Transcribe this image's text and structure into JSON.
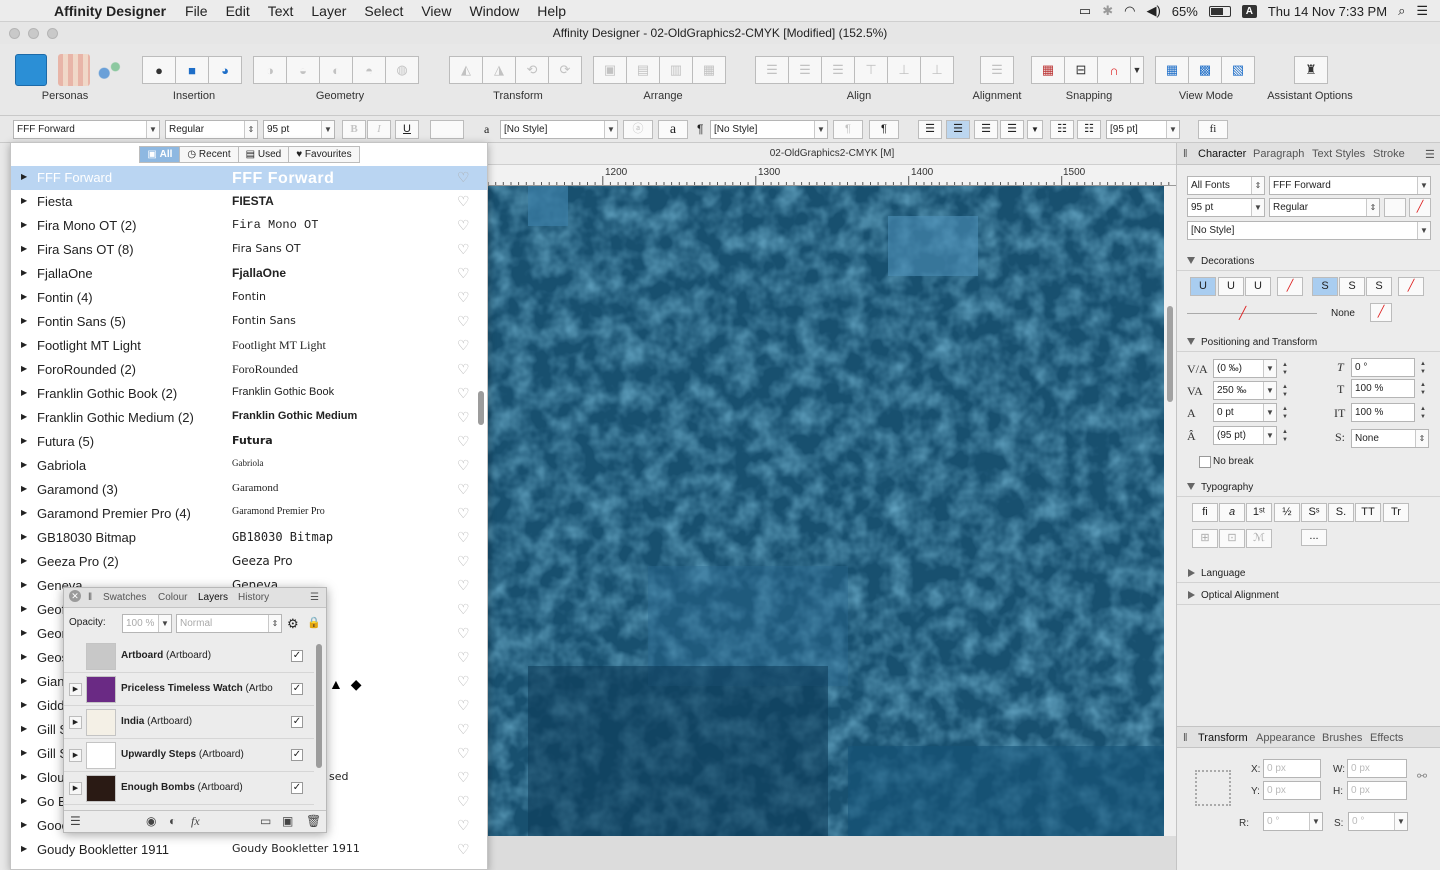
{
  "menubar": {
    "app_name": "Affinity Designer",
    "items": [
      "File",
      "Edit",
      "Text",
      "Layer",
      "Select",
      "View",
      "Window",
      "Help"
    ],
    "battery": "65%",
    "account": "A",
    "clock": "Thu 14 Nov  7:33 PM"
  },
  "window": {
    "title": "Affinity Designer - 02-OldGraphics2-CMYK [Modified] (152.5%)"
  },
  "toolbar": {
    "labels": {
      "personas": "Personas",
      "insertion": "Insertion",
      "geometry": "Geometry",
      "transform": "Transform",
      "arrange": "Arrange",
      "align": "Align",
      "alignment": "Alignment",
      "snapping": "Snapping",
      "view_mode": "View Mode",
      "assistant": "Assistant Options"
    }
  },
  "context": {
    "font_family": "FFF Forward",
    "font_style": "Regular",
    "font_size": "95 pt",
    "bold": "B",
    "italic": "I",
    "underline": "U",
    "char_style": "[No Style]",
    "para_style": "[No Style]",
    "pilcrow": "¶",
    "leading": "[95 pt]",
    "ligature": "fi",
    "a_glyph": "a"
  },
  "font_panel": {
    "filters": [
      "All",
      "Recent",
      "Used",
      "Favourites"
    ],
    "fonts": [
      {
        "name": "FFF Forward",
        "preview": "FFF Forward"
      },
      {
        "name": "Fiesta",
        "preview": "FIESTA"
      },
      {
        "name": "Fira Mono OT (2)",
        "preview": "Fira Mono OT"
      },
      {
        "name": "Fira Sans OT (8)",
        "preview": "Fira Sans OT"
      },
      {
        "name": "FjallaOne",
        "preview": "FjallaOne"
      },
      {
        "name": "Fontin (4)",
        "preview": "Fontin"
      },
      {
        "name": "Fontin Sans (5)",
        "preview": "Fontin Sans"
      },
      {
        "name": "Footlight MT Light",
        "preview": "Footlight MT Light"
      },
      {
        "name": "ForoRounded (2)",
        "preview": "ForoRounded"
      },
      {
        "name": "Franklin Gothic Book (2)",
        "preview": "Franklin Gothic Book"
      },
      {
        "name": "Franklin Gothic Medium (2)",
        "preview": "Franklin Gothic Medium"
      },
      {
        "name": "Futura (5)",
        "preview": "Futura"
      },
      {
        "name": "Gabriola",
        "preview": "Gabriola"
      },
      {
        "name": "Garamond (3)",
        "preview": "Garamond"
      },
      {
        "name": "Garamond Premier Pro (4)",
        "preview": "Garamond Premier Pro"
      },
      {
        "name": "GB18030 Bitmap",
        "preview": "GB18030  Bitmap"
      },
      {
        "name": "Geeza Pro (2)",
        "preview": "Geeza Pro"
      },
      {
        "name": "Geneva",
        "preview": "Geneva"
      },
      {
        "name": "Geof",
        "preview": ""
      },
      {
        "name": "Geor",
        "preview": ""
      },
      {
        "name": "Geos",
        "preview": ""
      },
      {
        "name": "Gian",
        "preview": ""
      },
      {
        "name": "Gidd",
        "preview": ""
      },
      {
        "name": "Gill S",
        "preview": ""
      },
      {
        "name": "Gill S",
        "preview": ""
      },
      {
        "name": "Glou",
        "preview": "sed"
      },
      {
        "name": "Go B",
        "preview": ""
      },
      {
        "name": "Gooc",
        "preview": ""
      },
      {
        "name": "Goudy Bookletter 1911",
        "preview": "Goudy Bookletter 1911"
      }
    ]
  },
  "layers_panel": {
    "tabs": [
      "Swatches",
      "Colour",
      "Layers",
      "History"
    ],
    "opacity_label": "Opacity:",
    "opacity_value": "100 %",
    "blend_mode": "Normal",
    "layers": [
      {
        "name": "Artboard",
        "kind": "(Artboard)",
        "thumb": "#c8c8c8",
        "checked": "✓"
      },
      {
        "name": "Priceless Timeless Watch",
        "kind": "(Artbo",
        "thumb": "#6a2a84",
        "checked": "✓"
      },
      {
        "name": "India",
        "kind": "(Artboard)",
        "thumb": "#f4f0e6",
        "checked": "✓"
      },
      {
        "name": "Upwardly Steps",
        "kind": "(Artboard)",
        "thumb": "#ffffff",
        "checked": "✓"
      },
      {
        "name": "Enough Bombs",
        "kind": "(Artboard)",
        "thumb": "#2a1a14",
        "checked": "✓"
      }
    ],
    "footer_fx": "fx"
  },
  "canvas": {
    "tab_title": "02-OldGraphics2-CMYK [M]",
    "ruler_ticks": [
      "1200",
      "1300",
      "1400",
      "1500"
    ],
    "color": "#1a5478"
  },
  "character_panel": {
    "tabs": [
      "Character",
      "Paragraph",
      "Text Styles",
      "Stroke"
    ],
    "font_collection": "All Fonts",
    "font_family": "FFF Forward",
    "font_size": "95 pt",
    "font_style": "Regular",
    "style": "[No Style]",
    "decorations": {
      "heading": "Decorations",
      "line_value": "None"
    },
    "positioning": {
      "heading": "Positioning and Transform",
      "kerning": "(0 ‰)",
      "tracking": "250 ‰",
      "baseline": "0 pt",
      "leading": "(95 pt)",
      "shear": "0 °",
      "hscale": "100 %",
      "vscale": "100 %",
      "superscript": "None",
      "no_break": "No break"
    },
    "typography": {
      "heading": "Typography",
      "more": "..."
    },
    "language": {
      "heading": "Language"
    },
    "optical": {
      "heading": "Optical Alignment"
    }
  },
  "transform_panel": {
    "tabs": [
      "Transform",
      "Appearance",
      "Brushes",
      "Effects"
    ],
    "x_label": "X:",
    "y_label": "Y:",
    "w_label": "W:",
    "h_label": "H:",
    "r_label": "R:",
    "s_label": "S:",
    "x": "0 px",
    "y": "0 px",
    "w": "0 px",
    "h": "0 px",
    "r": "0 °",
    "s": "0 °"
  }
}
